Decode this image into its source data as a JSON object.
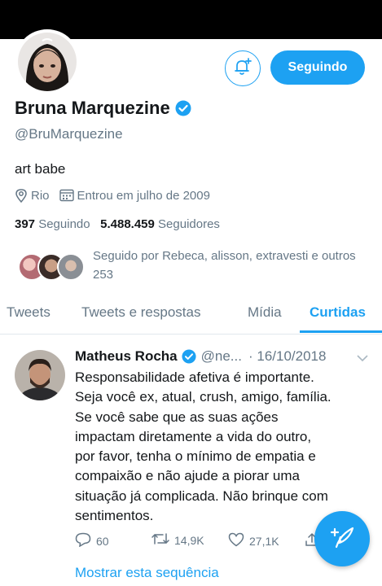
{
  "profile": {
    "name": "Bruna Marquezine",
    "handle": "@BruMarquezine",
    "bio": "art babe",
    "location": "Rio",
    "joined": "Entrou em julho de 2009",
    "following_count": "397",
    "following_label": "Seguindo",
    "followers_count": "5.488.459",
    "followers_label": "Seguidores",
    "followed_by": "Seguido por Rebeca, alisson, extravesti e outros 253",
    "follow_button": "Seguindo"
  },
  "icons": {
    "notify": "bell-plus-icon",
    "verified": "verified-badge-icon",
    "location": "location-pin-icon",
    "joined": "calendar-icon",
    "reply": "reply-icon",
    "retweet": "retweet-icon",
    "like": "heart-icon",
    "share": "share-icon",
    "compose": "compose-tweet-icon",
    "more": "chevron-down-icon"
  },
  "tabs": [
    {
      "label": "Tweets"
    },
    {
      "label": "Tweets e respostas"
    },
    {
      "label": "Mídia"
    },
    {
      "label": "Curtidas"
    }
  ],
  "active_tab": "Curtidas",
  "tweet": {
    "author": "Matheus Rocha",
    "handle": "@ne...",
    "date": "· 16/10/2018",
    "lines": [
      "Responsabilidade afetiva é importante.",
      "Seja você ex, atual, crush, amigo, família.",
      "Se você sabe que as suas ações",
      "impactam diretamente a vida do outro,",
      "por favor, tenha o mínimo de empatia e",
      "compaixão e não ajude a piorar uma",
      "situação já complicada. Não brinque com",
      "sentimentos."
    ],
    "replies": "60",
    "retweets": "14,9K",
    "likes": "27,1K",
    "show_thread": "Mostrar esta sequência"
  },
  "colors": {
    "accent": "#1da1f2",
    "text": "#14171a",
    "secondary": "#657786"
  }
}
